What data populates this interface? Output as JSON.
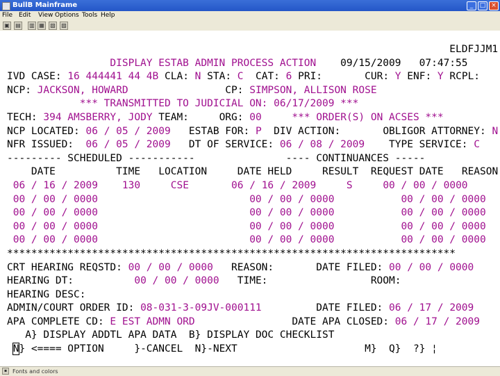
{
  "window": {
    "title": "BullB Mainframe",
    "minimize": "_",
    "maximize": "□",
    "close": "×"
  },
  "menu": [
    "File",
    "Edit",
    "View",
    "Options",
    "Tools",
    "Help"
  ],
  "status_bar": "Fonts and colors",
  "screen": {
    "screen_id": "ELDFJJM1",
    "title": "DISPLAY ESTAB ADMIN PROCESS ACTION",
    "date": "09/15/2009",
    "time": "07:47:55",
    "ivd_case_label": "IVD CASE:",
    "ivd_case": "16 444441 44 4B",
    "cla_label": "CLA:",
    "cla": "N",
    "sta_label": "STA:",
    "sta": "C",
    "cat_label": "CAT:",
    "cat": "6",
    "pri_label": "PRI:",
    "cur_label": "CUR:",
    "cur": "Y",
    "enf_label": "ENF:",
    "enf": "Y",
    "rcpl_label": "RCPL:",
    "ncp_label": "NCP:",
    "ncp": "JACKSON, HOWARD",
    "cp_label": "CP:",
    "cp": "SIMPSON, ALLISON ROSE",
    "transmitted_label": "*** TRANSMITTED TO JUDICIAL ON:",
    "transmitted_date": "06/17/2009",
    "transmitted_end": "***",
    "tech_label": "TECH:",
    "tech": "394 AMSBERRY, JODY",
    "team_label": "TEAM:",
    "org_label": "ORG:",
    "org": "00",
    "orders_msg": "*** ORDER(S) ON ACSES ***",
    "ncp_located_label": "NCP LOCATED:",
    "ncp_located": "06 / 05 / 2009",
    "estab_for_label": "ESTAB FOR:",
    "estab_for": "P",
    "div_action_label": "DIV ACTION:",
    "obligor_attorney_label": "OBLIGOR ATTORNEY:",
    "obligor_attorney": "N",
    "nfr_issued_label": "NFR ISSUED:",
    "nfr_issued": "06 / 05 / 2009",
    "dt_service_label": "DT OF SERVICE:",
    "dt_service": "06 / 08 / 2009",
    "type_service_label": "TYPE SERVICE:",
    "type_service": "C",
    "scheduled_header": "--------- SCHEDULED -----------",
    "continuances_header": "---- CONTINUANCES -----",
    "col_date": "DATE",
    "col_time": "TIME",
    "col_location": "LOCATION",
    "col_date_held": "DATE HELD",
    "col_result": "RESULT",
    "col_request_date": "REQUEST DATE",
    "col_reason": "REASON",
    "rows": [
      {
        "date": "06 / 16 / 2009",
        "time": "130",
        "location": "CSE",
        "date_held": "06 / 16 / 2009",
        "result": "S",
        "request_date": "00 / 00 / 0000"
      },
      {
        "date": "00 / 00 / 0000",
        "time": "",
        "location": "",
        "date_held": "00 / 00 / 0000",
        "result": "",
        "request_date": "00 / 00 / 0000"
      },
      {
        "date": "00 / 00 / 0000",
        "time": "",
        "location": "",
        "date_held": "00 / 00 / 0000",
        "result": "",
        "request_date": "00 / 00 / 0000"
      },
      {
        "date": "00 / 00 / 0000",
        "time": "",
        "location": "",
        "date_held": "00 / 00 / 0000",
        "result": "",
        "request_date": "00 / 00 / 0000"
      },
      {
        "date": "00 / 00 / 0000",
        "time": "",
        "location": "",
        "date_held": "00 / 00 / 0000",
        "result": "",
        "request_date": "00 / 00 / 0000"
      }
    ],
    "separator": "**************************************************************************",
    "crt_hearing_label": "CRT HEARING REQSTD:",
    "crt_hearing": "00 / 00 / 0000",
    "reason_label": "REASON:",
    "date_filed_label": "DATE FILED:",
    "crt_date_filed": "00 / 00 / 0000",
    "hearing_dt_label": "HEARING DT:",
    "hearing_dt": "00 / 00 / 0000",
    "time_label": "TIME:",
    "room_label": "ROOM:",
    "hearing_desc_label": "HEARING DESC:",
    "order_id_label": "ADMIN/COURT ORDER ID:",
    "order_id": "08-031-3-09JV-000111",
    "order_date_filed": "06 / 17 / 2009",
    "apa_complete_label": "APA COMPLETE CD:",
    "apa_complete": "E EST ADMN ORD",
    "apa_closed_label": "DATE APA CLOSED:",
    "apa_closed": "06 / 17 / 2009",
    "option_a": "A} DISPLAY ADDTL APA DATA",
    "option_b": "B} DISPLAY DOC CHECKLIST",
    "option_value": "N",
    "option_prompt": "} <==== OPTION",
    "cancel": "}-CANCEL",
    "next": "N}-NEXT",
    "m_key": "M}",
    "q_key": "Q}",
    "help_key": "?} ¦"
  }
}
